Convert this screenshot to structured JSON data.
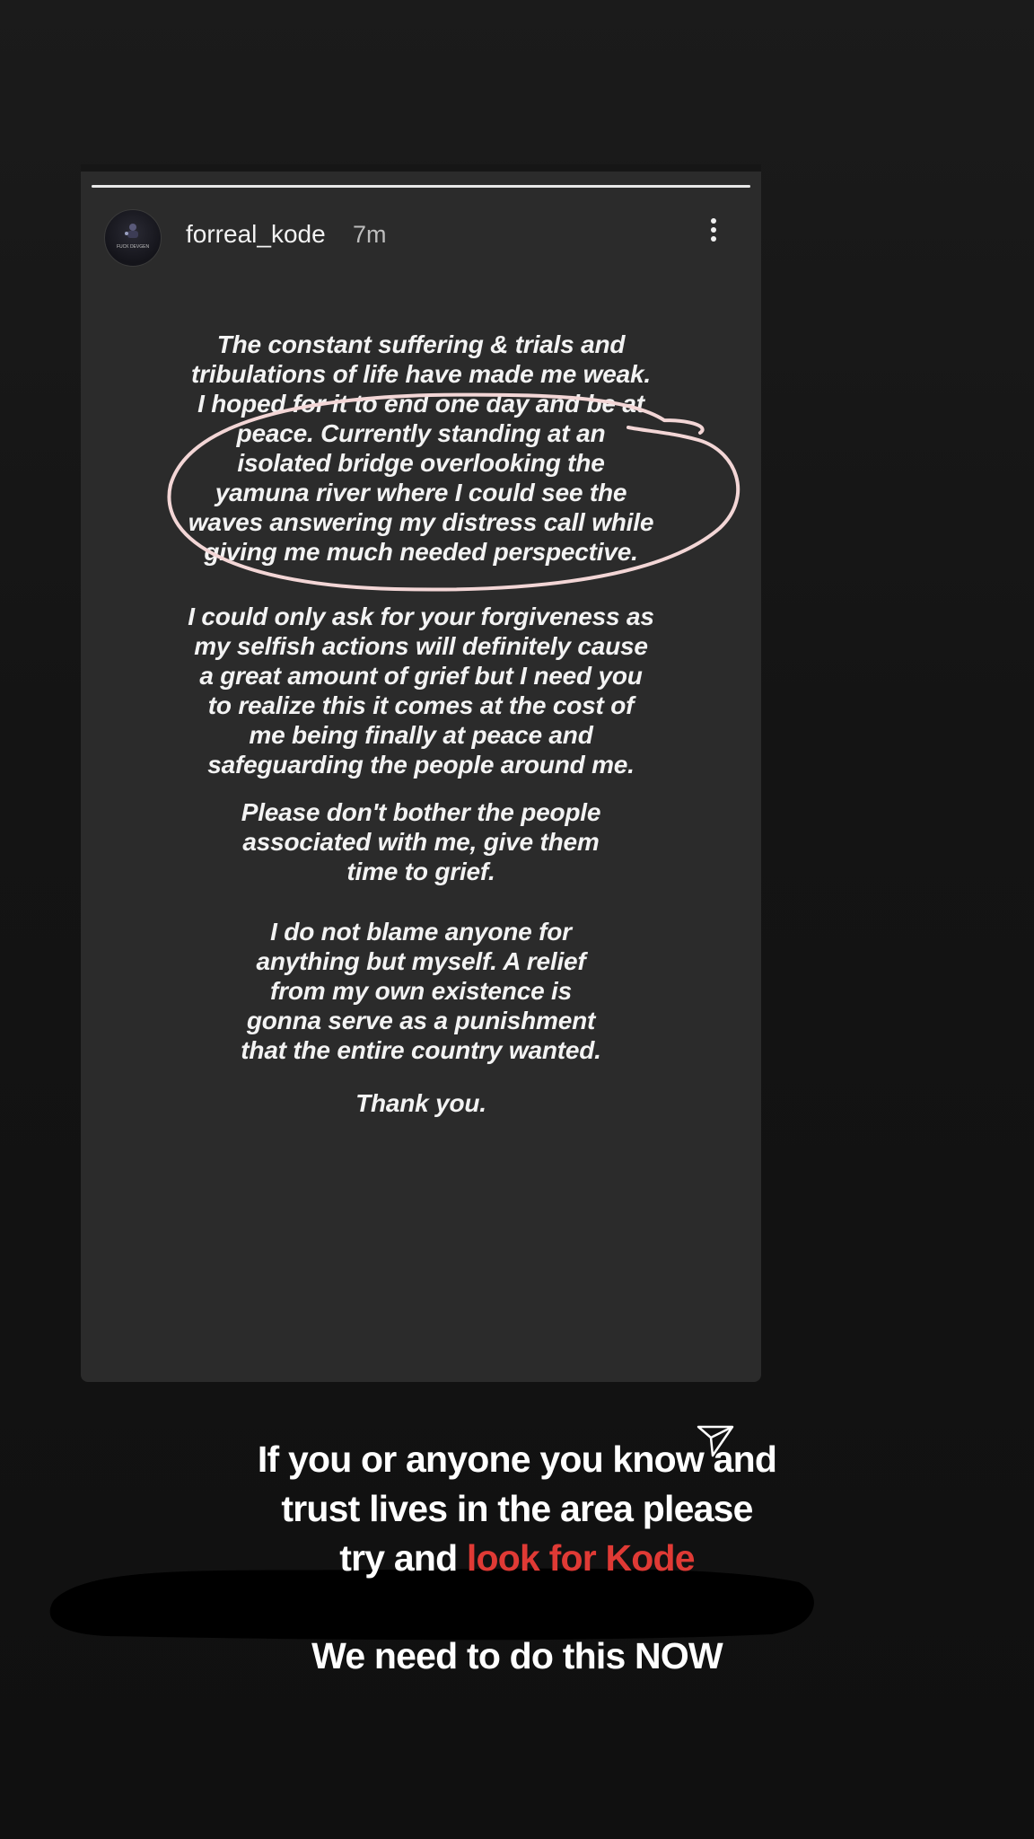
{
  "story": {
    "username": "forreal_kode",
    "time_ago": "7m",
    "avatar_text": "FUCK DEVGEN",
    "progress": 1.0,
    "paragraphs": {
      "p1": [
        "The constant suffering & trials and",
        "tribulations of life have made me weak.",
        "I hoped for it to end one day and be at",
        "peace. Currently standing at an",
        "isolated bridge overlooking the",
        "yamuna river where I could see the",
        "waves answering my distress call while",
        "giving me much needed perspective."
      ],
      "p2": [
        "I could only ask for your forgiveness as",
        "my selfish actions will definitely cause",
        "a great amount of grief but I need you",
        "to realize this it comes at the cost of",
        "me being finally at peace and",
        "safeguarding the people around me."
      ],
      "p3": [
        "Please don't bother the people",
        "associated with me, give them",
        "time to grief."
      ],
      "p4": [
        "I do not blame anyone for",
        "anything but myself. A relief",
        "from my own existence is",
        "gonna serve as a punishment",
        "that the entire country wanted."
      ],
      "p5": [
        "Thank you."
      ]
    },
    "icons": {
      "more": "more-vertical-icon",
      "send": "send-icon"
    }
  },
  "overlay": {
    "callout_line1": "If you or anyone you know and",
    "callout_line2": "trust lives in the area please",
    "callout_line3_prefix": "try and ",
    "callout_line3_highlight": "look for Kode",
    "urgent": "We need to do this NOW",
    "highlight_color": "#e03a35",
    "annotation_color": "#f3d6d6"
  }
}
